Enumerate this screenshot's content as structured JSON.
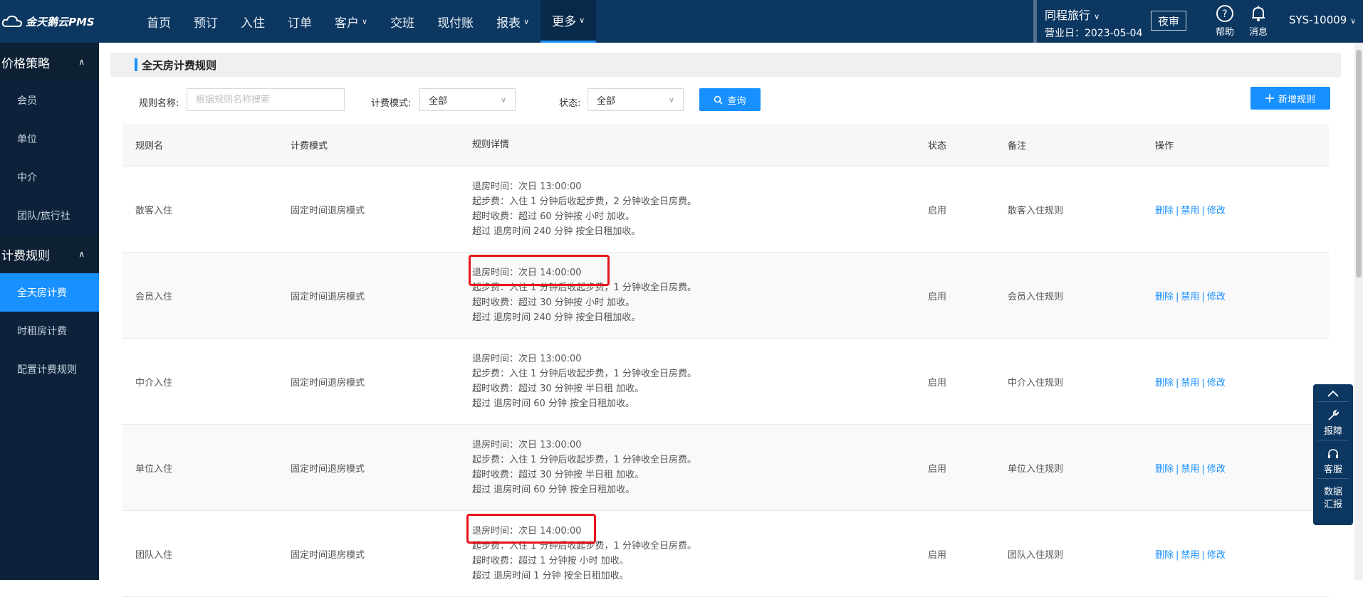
{
  "brand": {
    "name": "金天鹅云PMS"
  },
  "nav": [
    {
      "label": "首页",
      "chev": false
    },
    {
      "label": "预订",
      "chev": false
    },
    {
      "label": "入住",
      "chev": false
    },
    {
      "label": "订单",
      "chev": false
    },
    {
      "label": "客户",
      "chev": true
    },
    {
      "label": "交班",
      "chev": false
    },
    {
      "label": "现付账",
      "chev": false
    },
    {
      "label": "报表",
      "chev": true
    },
    {
      "label": "更多",
      "chev": true,
      "active": true
    }
  ],
  "hotel": {
    "name": "同程旅行",
    "date_label": "营业日：2023-05-04"
  },
  "night_audit": "夜审",
  "help": "帮助",
  "messages": "消息",
  "user": "SYS-10009",
  "sidebar": {
    "groups": [
      {
        "title": "价格策略",
        "items": [
          "会员",
          "单位",
          "中介",
          "团队/旅行社"
        ]
      },
      {
        "title": "计费规则",
        "items": [
          "全天房计费",
          "时租房计费",
          "配置计费规则"
        ],
        "active": "全天房计费"
      }
    ]
  },
  "page": {
    "title": "全天房计费规则"
  },
  "filters": {
    "rule_name_label": "规则名称:",
    "rule_name_placeholder": "根据规则名称搜索",
    "mode_label": "计费模式:",
    "mode_value": "全部",
    "status_label": "状态:",
    "status_value": "全部",
    "search_button": "查询",
    "add_button": "新增规则"
  },
  "table": {
    "headers": [
      "规则名",
      "计费模式",
      "规则详情",
      "状态",
      "备注",
      "操作"
    ],
    "ops": [
      "删除",
      "禁用",
      "修改"
    ],
    "rows": [
      {
        "name": "散客入住",
        "mode": "固定时间退房模式",
        "details": [
          "退房时间：次日 13:00:00",
          "起步费：入住 1 分钟后收起步费，2 分钟收全日房费。",
          "超时收费：超过 60 分钟按 小时 加收。",
          "超过 退房时间 240 分钟 按全日租加收。"
        ],
        "status": "启用",
        "note": "散客入住规则",
        "highlight": false
      },
      {
        "name": "会员入住",
        "mode": "固定时间退房模式",
        "details": [
          "退房时间：次日 14:00:00",
          "起步费：入住 1 分钟后收起步费，1 分钟收全日房费。",
          "超时收费：超过 30 分钟按 小时 加收。",
          "超过 退房时间 240 分钟 按全日租加收。"
        ],
        "status": "启用",
        "note": "会员入住规则",
        "highlight": true
      },
      {
        "name": "中介入住",
        "mode": "固定时间退房模式",
        "details": [
          "退房时间：次日 13:00:00",
          "起步费：入住 1 分钟后收起步费，1 分钟收全日房费。",
          "超时收费：超过 30 分钟按 半日租 加收。",
          "超过 退房时间 60 分钟 按全日租加收。"
        ],
        "status": "启用",
        "note": "中介入住规则",
        "highlight": false
      },
      {
        "name": "单位入住",
        "mode": "固定时间退房模式",
        "details": [
          "退房时间：次日 13:00:00",
          "起步费：入住 1 分钟后收起步费，1 分钟收全日房费。",
          "超时收费：超过 30 分钟按 半日租 加收。",
          "超过 退房时间 60 分钟 按全日租加收。"
        ],
        "status": "启用",
        "note": "单位入住规则",
        "highlight": false
      },
      {
        "name": "团队入住",
        "mode": "固定时间退房模式",
        "details": [
          "退房时间：次日 14:00:00",
          "起步费：入住 1 分钟后收起步费，1 分钟收全日房费。",
          "超时收费：超过 1 分钟按 小时 加收。",
          "超过 退房时间 1 分钟 按全日租加收。"
        ],
        "status": "启用",
        "note": "团队入住规则",
        "highlight": true
      }
    ]
  },
  "float_panel": {
    "report": "报障",
    "service": "客服",
    "data1": "数据",
    "data2": "汇报"
  },
  "colors": {
    "topbar": "#0c3761",
    "sidebar": "#0d223a",
    "accent": "#1890ff",
    "highlight": "#e8141b"
  }
}
